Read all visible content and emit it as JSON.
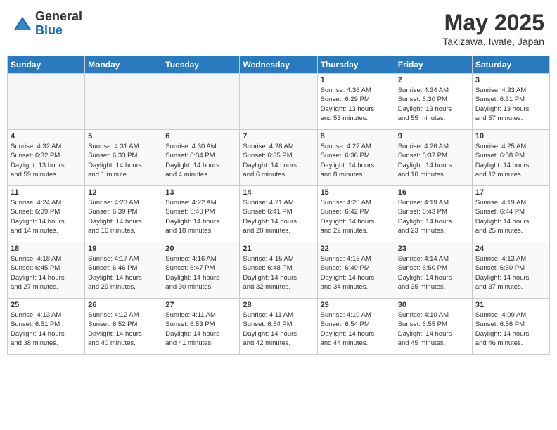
{
  "header": {
    "logo_general": "General",
    "logo_blue": "Blue",
    "month_year": "May 2025",
    "location": "Takizawa, Iwate, Japan"
  },
  "days_of_week": [
    "Sunday",
    "Monday",
    "Tuesday",
    "Wednesday",
    "Thursday",
    "Friday",
    "Saturday"
  ],
  "weeks": [
    [
      {
        "day": "",
        "info": ""
      },
      {
        "day": "",
        "info": ""
      },
      {
        "day": "",
        "info": ""
      },
      {
        "day": "",
        "info": ""
      },
      {
        "day": "1",
        "info": "Sunrise: 4:36 AM\nSunset: 6:29 PM\nDaylight: 13 hours\nand 53 minutes."
      },
      {
        "day": "2",
        "info": "Sunrise: 4:34 AM\nSunset: 6:30 PM\nDaylight: 13 hours\nand 55 minutes."
      },
      {
        "day": "3",
        "info": "Sunrise: 4:33 AM\nSunset: 6:31 PM\nDaylight: 13 hours\nand 57 minutes."
      }
    ],
    [
      {
        "day": "4",
        "info": "Sunrise: 4:32 AM\nSunset: 6:32 PM\nDaylight: 13 hours\nand 59 minutes."
      },
      {
        "day": "5",
        "info": "Sunrise: 4:31 AM\nSunset: 6:33 PM\nDaylight: 14 hours\nand 1 minute."
      },
      {
        "day": "6",
        "info": "Sunrise: 4:30 AM\nSunset: 6:34 PM\nDaylight: 14 hours\nand 4 minutes."
      },
      {
        "day": "7",
        "info": "Sunrise: 4:28 AM\nSunset: 6:35 PM\nDaylight: 14 hours\nand 6 minutes."
      },
      {
        "day": "8",
        "info": "Sunrise: 4:27 AM\nSunset: 6:36 PM\nDaylight: 14 hours\nand 8 minutes."
      },
      {
        "day": "9",
        "info": "Sunrise: 4:26 AM\nSunset: 6:37 PM\nDaylight: 14 hours\nand 10 minutes."
      },
      {
        "day": "10",
        "info": "Sunrise: 4:25 AM\nSunset: 6:38 PM\nDaylight: 14 hours\nand 12 minutes."
      }
    ],
    [
      {
        "day": "11",
        "info": "Sunrise: 4:24 AM\nSunset: 6:39 PM\nDaylight: 14 hours\nand 14 minutes."
      },
      {
        "day": "12",
        "info": "Sunrise: 4:23 AM\nSunset: 6:39 PM\nDaylight: 14 hours\nand 16 minutes."
      },
      {
        "day": "13",
        "info": "Sunrise: 4:22 AM\nSunset: 6:40 PM\nDaylight: 14 hours\nand 18 minutes."
      },
      {
        "day": "14",
        "info": "Sunrise: 4:21 AM\nSunset: 6:41 PM\nDaylight: 14 hours\nand 20 minutes."
      },
      {
        "day": "15",
        "info": "Sunrise: 4:20 AM\nSunset: 6:42 PM\nDaylight: 14 hours\nand 22 minutes."
      },
      {
        "day": "16",
        "info": "Sunrise: 4:19 AM\nSunset: 6:43 PM\nDaylight: 14 hours\nand 23 minutes."
      },
      {
        "day": "17",
        "info": "Sunrise: 4:19 AM\nSunset: 6:44 PM\nDaylight: 14 hours\nand 25 minutes."
      }
    ],
    [
      {
        "day": "18",
        "info": "Sunrise: 4:18 AM\nSunset: 6:45 PM\nDaylight: 14 hours\nand 27 minutes."
      },
      {
        "day": "19",
        "info": "Sunrise: 4:17 AM\nSunset: 6:46 PM\nDaylight: 14 hours\nand 29 minutes."
      },
      {
        "day": "20",
        "info": "Sunrise: 4:16 AM\nSunset: 6:47 PM\nDaylight: 14 hours\nand 30 minutes."
      },
      {
        "day": "21",
        "info": "Sunrise: 4:15 AM\nSunset: 6:48 PM\nDaylight: 14 hours\nand 32 minutes."
      },
      {
        "day": "22",
        "info": "Sunrise: 4:15 AM\nSunset: 6:49 PM\nDaylight: 14 hours\nand 34 minutes."
      },
      {
        "day": "23",
        "info": "Sunrise: 4:14 AM\nSunset: 6:50 PM\nDaylight: 14 hours\nand 35 minutes."
      },
      {
        "day": "24",
        "info": "Sunrise: 4:13 AM\nSunset: 6:50 PM\nDaylight: 14 hours\nand 37 minutes."
      }
    ],
    [
      {
        "day": "25",
        "info": "Sunrise: 4:13 AM\nSunset: 6:51 PM\nDaylight: 14 hours\nand 38 minutes."
      },
      {
        "day": "26",
        "info": "Sunrise: 4:12 AM\nSunset: 6:52 PM\nDaylight: 14 hours\nand 40 minutes."
      },
      {
        "day": "27",
        "info": "Sunrise: 4:11 AM\nSunset: 6:53 PM\nDaylight: 14 hours\nand 41 minutes."
      },
      {
        "day": "28",
        "info": "Sunrise: 4:11 AM\nSunset: 6:54 PM\nDaylight: 14 hours\nand 42 minutes."
      },
      {
        "day": "29",
        "info": "Sunrise: 4:10 AM\nSunset: 6:54 PM\nDaylight: 14 hours\nand 44 minutes."
      },
      {
        "day": "30",
        "info": "Sunrise: 4:10 AM\nSunset: 6:55 PM\nDaylight: 14 hours\nand 45 minutes."
      },
      {
        "day": "31",
        "info": "Sunrise: 4:09 AM\nSunset: 6:56 PM\nDaylight: 14 hours\nand 46 minutes."
      }
    ]
  ]
}
